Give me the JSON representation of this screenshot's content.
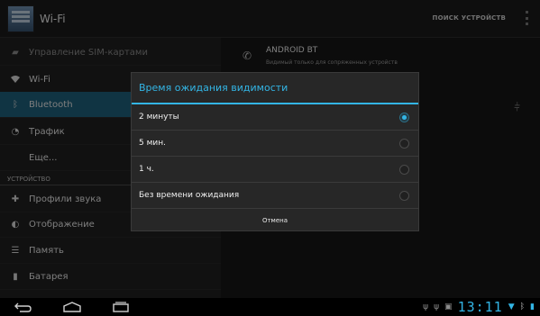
{
  "actionbar": {
    "title": "Wi-Fi",
    "search_devices": "ПОИСК УСТРОЙСТВ"
  },
  "left_list": {
    "items": [
      {
        "label": "Управление SIM-картами",
        "icon": "sim-card-icon"
      },
      {
        "label": "Wi-Fi",
        "icon": "wifi-icon"
      },
      {
        "label": "Bluetooth",
        "icon": "bluetooth-icon"
      },
      {
        "label": "Трафик",
        "icon": "data-usage-icon"
      },
      {
        "label": "Еще...",
        "icon": ""
      },
      {
        "label": "Профили звука",
        "icon": "sound-icon"
      },
      {
        "label": "Отображение",
        "icon": "display-icon"
      },
      {
        "label": "Память",
        "icon": "storage-icon"
      },
      {
        "label": "Батарея",
        "icon": "battery-icon"
      }
    ],
    "category_device": "УСТРОЙСТВО",
    "selected": "Bluetooth"
  },
  "right_pane": {
    "device_name": "ANDROID BT",
    "device_subtitle": "Видимый только для сопряженных устройств"
  },
  "dialog": {
    "title": "Время ожидания видимости",
    "options": [
      {
        "label": "2 минуты",
        "selected": true
      },
      {
        "label": "5 мин.",
        "selected": false
      },
      {
        "label": "1 ч.",
        "selected": false
      },
      {
        "label": "Без времени ожидания",
        "selected": false
      }
    ],
    "cancel_label": "Отмена"
  },
  "statusbar": {
    "time": "13:11"
  },
  "colors": {
    "accent": "#33b5e5",
    "selected_item": "#1e5f7a"
  }
}
